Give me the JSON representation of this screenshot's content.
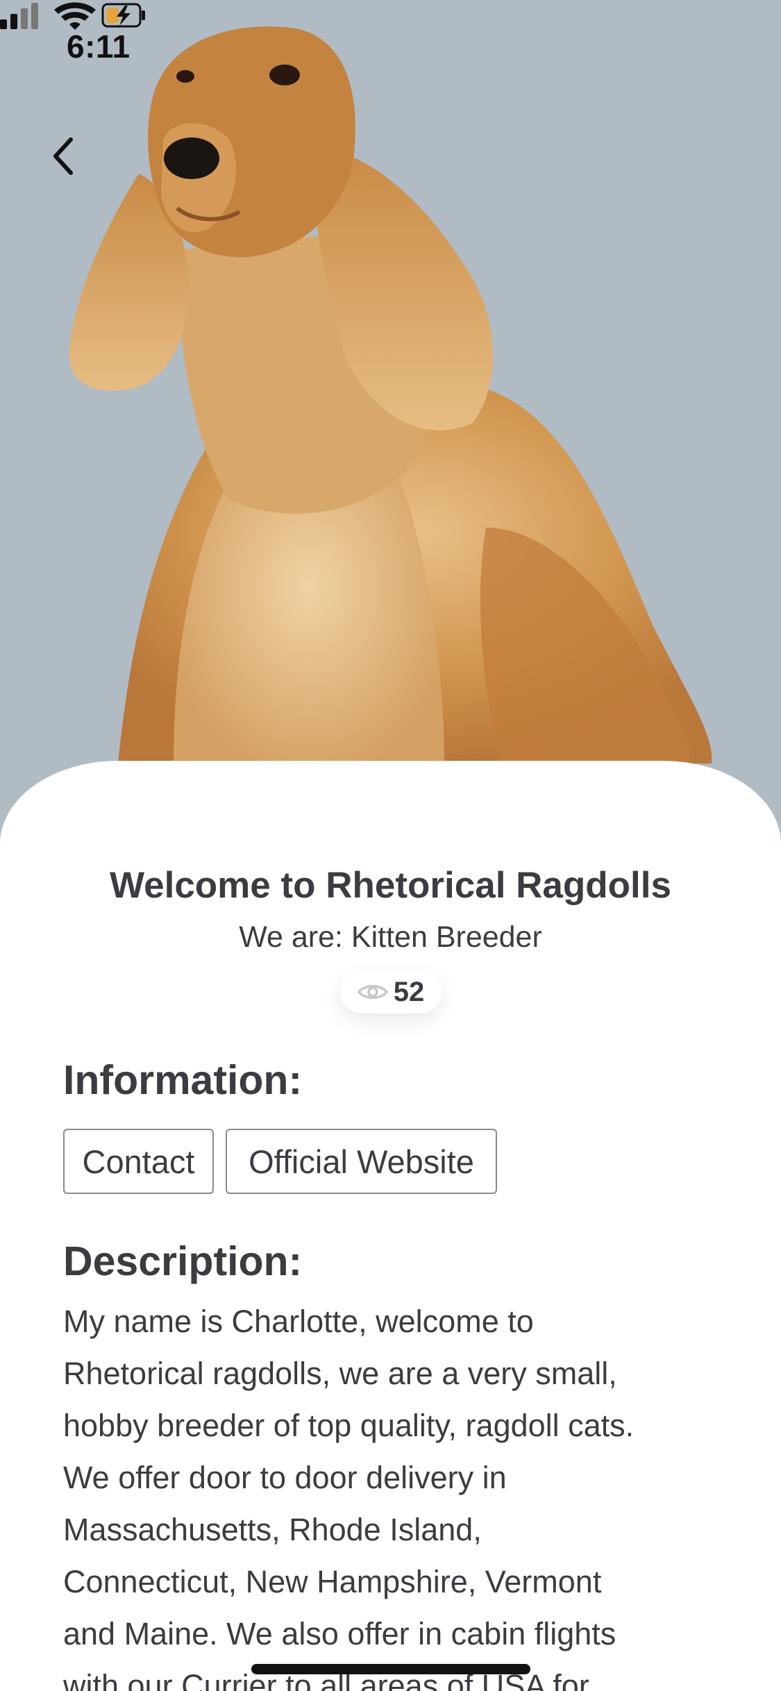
{
  "status_bar": {
    "time": "6:11"
  },
  "header": {
    "back_icon": "chevron-left-icon",
    "hero_image": "cocker-spaniel-photo"
  },
  "breeder": {
    "title": "Welcome to Rhetorical Ragdolls",
    "subtitle": "We are: Kitten Breeder",
    "views_icon": "eye-icon",
    "views_count": "52"
  },
  "information": {
    "heading": "Information:",
    "buttons": [
      {
        "label": "Contact"
      },
      {
        "label": "Official Website"
      }
    ]
  },
  "description": {
    "heading": "Description:",
    "lines": [
      "My name is Charlotte, welcome to",
      "Rhetorical ragdolls, we are a very small,",
      "hobby breeder of top quality, ragdoll cats.",
      "We offer door to door delivery in",
      "Massachusetts, Rhode Island,",
      "Connecticut, New Hampshire, Vermont",
      "and Maine. We also offer in cabin flights",
      "with our Currier to all areas of USA for"
    ]
  },
  "colors": {
    "hero_background": "#b0bbc4",
    "text": "#3b3c42",
    "button_border": "#8a8a8f"
  }
}
